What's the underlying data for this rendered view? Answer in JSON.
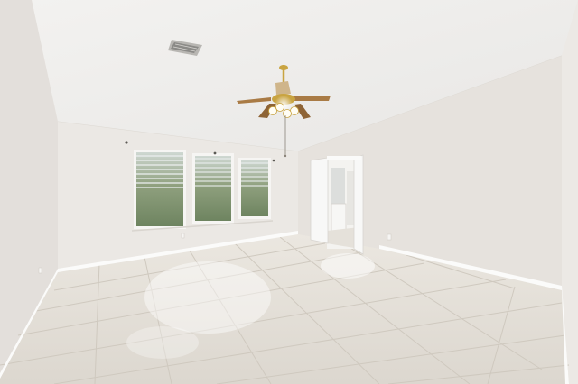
{
  "scene": {
    "kind": "photo",
    "subject": "empty bedroom",
    "features": [
      "vaulted-ceiling",
      "ceiling-fan-with-light",
      "air-vent",
      "three-windows-with-blinds",
      "open-double-doors-to-bathroom",
      "large-floor-tiles",
      "white-baseboards"
    ],
    "counts": {
      "windows": 3,
      "fan_blades": 4,
      "fan_lights": 4,
      "doors_open": 2
    }
  },
  "colors": {
    "ceiling": "#f2f1ef",
    "ceiling_slope": "#e9e8e6",
    "wall_left": "#e3dfdb",
    "wall_back": "#ebe8e4",
    "wall_right": "#e6e2dd",
    "wall_far_right": "#ece9e5",
    "floor": "#e3dfd7",
    "grout": "#cfc9bf",
    "baseboard": "#fbfbfa",
    "window_frame": "#f6f5f3",
    "window_glass": "#7e9170",
    "blinds": "#eceff0",
    "fan_brass": "#c9a441",
    "fan_blade": "#a97b45",
    "doorway": "#f4f3f0"
  }
}
